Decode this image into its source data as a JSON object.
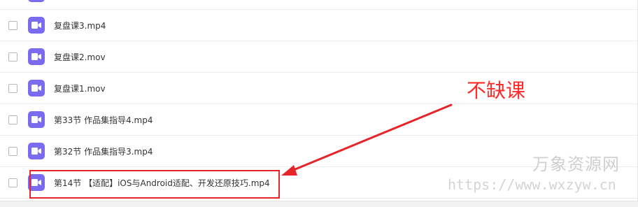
{
  "files": [
    {
      "name": "",
      "icon": "video-file-icon"
    },
    {
      "name": "复盘课3.mp4",
      "icon": "video-file-icon"
    },
    {
      "name": "复盘课2.mov",
      "icon": "video-file-icon"
    },
    {
      "name": "复盘课1.mov",
      "icon": "video-file-icon"
    },
    {
      "name": "第33节 作品集指导4.mp4",
      "icon": "video-file-icon"
    },
    {
      "name": "第32节 作品集指导3.mp4",
      "icon": "video-file-icon"
    },
    {
      "name": "第14节 【适配】iOS与Android适配、开发还原技巧.mp4",
      "icon": "video-file-icon"
    }
  ],
  "annotation": {
    "text": "不缺课",
    "color": "#ff2b2b"
  },
  "watermark": {
    "title": "万象资源网",
    "url": "https://www.wxzyw.cn"
  },
  "colors": {
    "icon_bg": "#7b6bf1",
    "highlight": "#e5252a"
  }
}
